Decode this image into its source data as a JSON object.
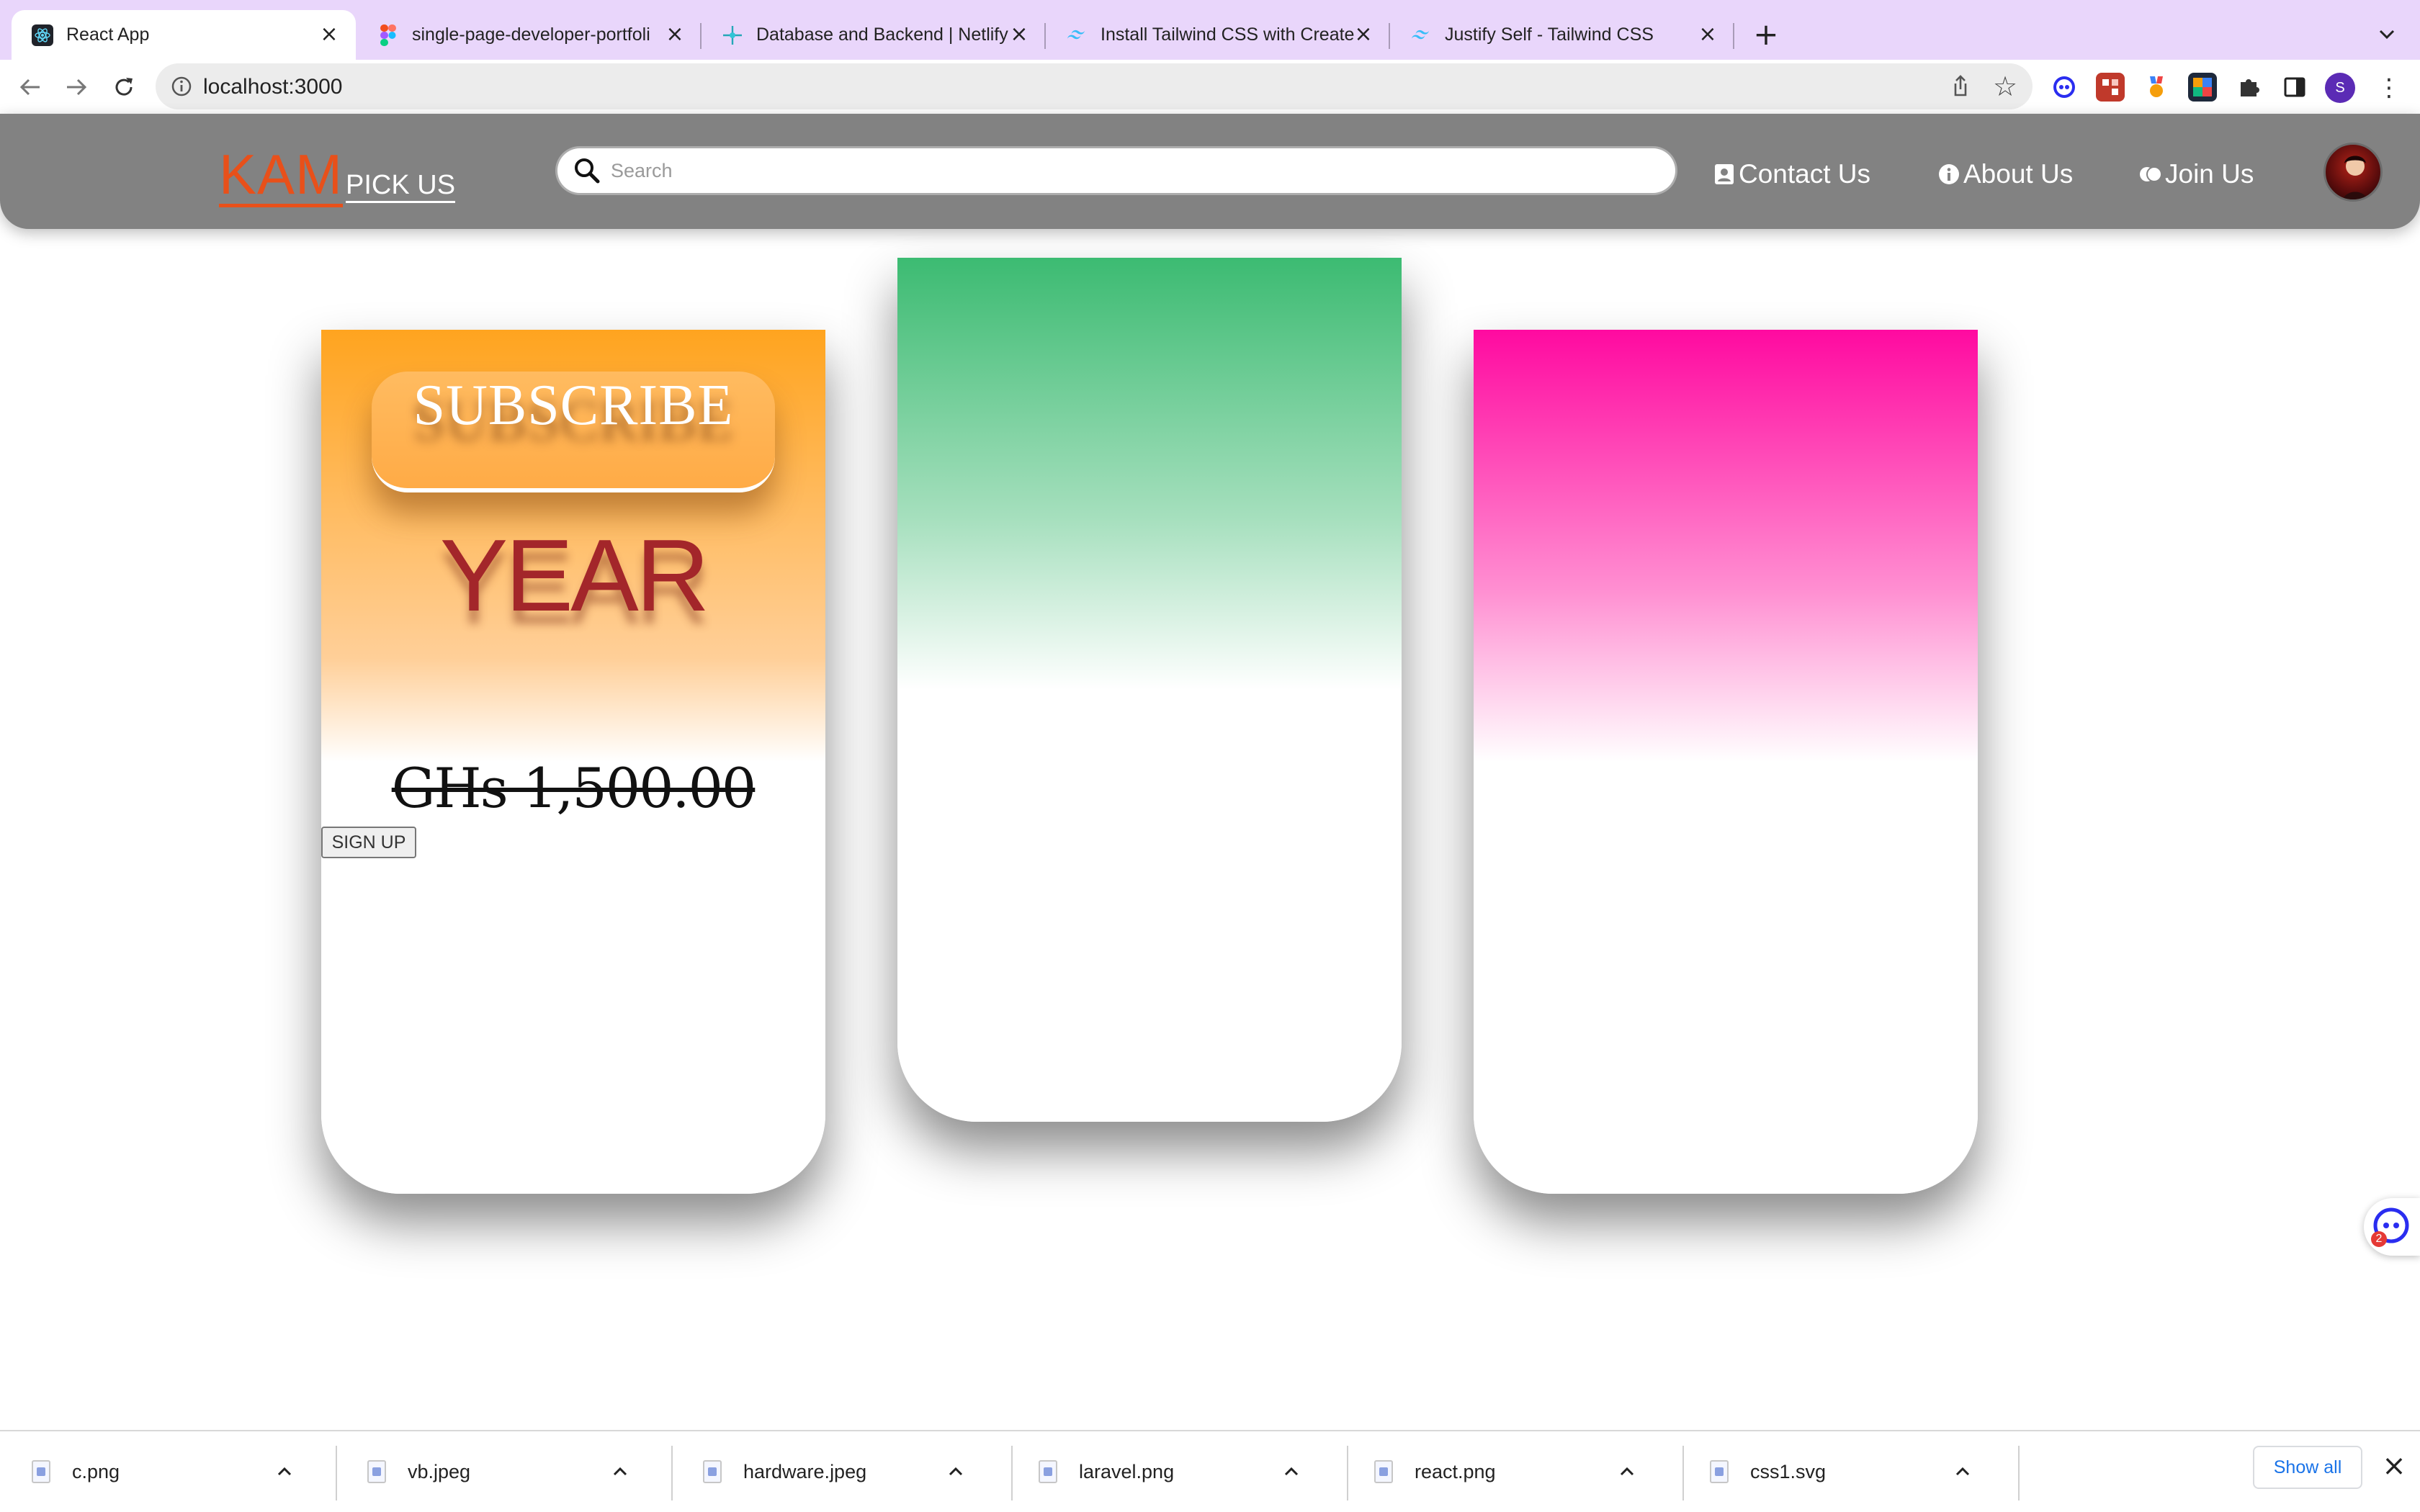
{
  "browser": {
    "tabs": [
      {
        "label": "React App",
        "favicon": "react-icon",
        "active": true
      },
      {
        "label": "single-page-developer-portfoli",
        "favicon": "figma-icon",
        "active": false
      },
      {
        "label": "Database and Backend | Netlify",
        "favicon": "netlify-icon",
        "active": false
      },
      {
        "label": "Install Tailwind CSS with Create",
        "favicon": "tailwind-icon",
        "active": false
      },
      {
        "label": "Justify Self - Tailwind CSS",
        "favicon": "tailwind-icon",
        "active": false
      }
    ],
    "tab_close_glyph": "×",
    "new_tab_glyph": "+",
    "address": "localhost:3000",
    "profile_initial": "S",
    "menu_glyph": "⋮",
    "star_glyph": "☆"
  },
  "site": {
    "logo_main": "KAM",
    "logo_sub": "PICK US",
    "search_placeholder": "Search",
    "nav": [
      {
        "label": "Contact Us",
        "icon": "contact-card-icon"
      },
      {
        "label": "About Us",
        "icon": "info-icon"
      },
      {
        "label": "Join Us",
        "icon": "join-icon"
      }
    ]
  },
  "cards": [
    {
      "badge": "SUBSCRIBE",
      "period": "YEAR",
      "price": "GHs 1,500.00",
      "button": "SIGN UP",
      "gradient_color": "#ffa41f"
    },
    {
      "gradient_color": "#3cbb72"
    },
    {
      "gradient_color": "#ff0aa0"
    }
  ],
  "helper_badge_count": "2",
  "downloads": {
    "files": [
      "c.png",
      "vb.jpeg",
      "hardware.jpeg",
      "laravel.png",
      "react.png",
      "css1.svg"
    ],
    "show_all": "Show all",
    "close_glyph": "×"
  }
}
